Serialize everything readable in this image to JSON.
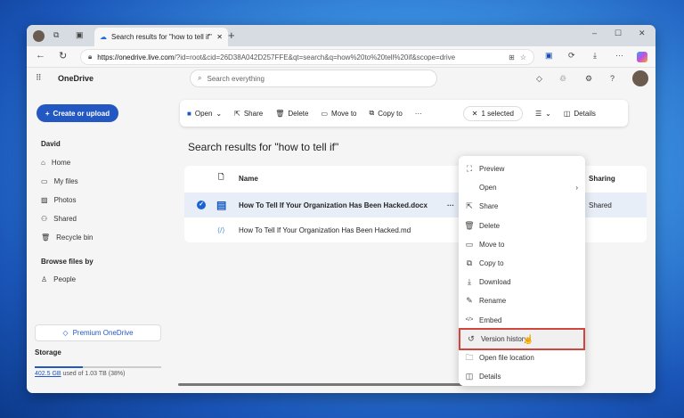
{
  "browser": {
    "tab_title": "Search results for \"how to tell if\"",
    "url_domain": "https://onedrive.live.com",
    "url_rest": "/?id=root&cid=26D38A042D257FFE&qt=search&q=how%20to%20tell%20if&scope=drive"
  },
  "app": {
    "name": "OneDrive",
    "search_placeholder": "Search everything"
  },
  "sidebar": {
    "create_label": "Create or upload",
    "user": "David",
    "items": [
      {
        "label": "Home"
      },
      {
        "label": "My files"
      },
      {
        "label": "Photos"
      },
      {
        "label": "Shared"
      },
      {
        "label": "Recycle bin"
      }
    ],
    "browse_heading": "Browse files by",
    "browse_items": [
      {
        "label": "People"
      }
    ],
    "premium_label": "Premium OneDrive",
    "storage_heading": "Storage",
    "storage_used": "402.5 GB",
    "storage_rest": " used of 1.03 TB (38%)",
    "storage_fraction": 0.38
  },
  "toolbar": {
    "open": "Open",
    "share": "Share",
    "delete": "Delete",
    "move": "Move to",
    "copy": "Copy to",
    "more": "···",
    "selected": "1 selected",
    "details": "Details"
  },
  "main": {
    "title": "Search results for \"how to tell if\"",
    "col_name": "Name",
    "col_sharing": "Sharing",
    "files": [
      {
        "name": "How To Tell If Your Organization Has Been Hacked.docx",
        "sharing": "Shared",
        "selected": true
      },
      {
        "name": "How To Tell If Your Organization Has Been Hacked.md",
        "sharing": "",
        "selected": false
      }
    ]
  },
  "context_menu": {
    "items": [
      {
        "label": "Preview",
        "icon": "preview-icon"
      },
      {
        "label": "Open",
        "icon": ""
      },
      {
        "label": "Share",
        "icon": "share-icon"
      },
      {
        "label": "Delete",
        "icon": "trash-icon"
      },
      {
        "label": "Move to",
        "icon": "move-icon"
      },
      {
        "label": "Copy to",
        "icon": "copy-icon"
      },
      {
        "label": "Download",
        "icon": "download-icon"
      },
      {
        "label": "Rename",
        "icon": "rename-icon"
      },
      {
        "label": "Embed",
        "icon": "embed-icon"
      },
      {
        "label": "Version history",
        "icon": "history-icon"
      },
      {
        "label": "Open file location",
        "icon": "folder-icon"
      },
      {
        "label": "Details",
        "icon": "details-icon"
      }
    ]
  },
  "colors": {
    "accent": "#2358c3",
    "highlight": "#d0463c",
    "selected_row": "#e8eef8"
  }
}
